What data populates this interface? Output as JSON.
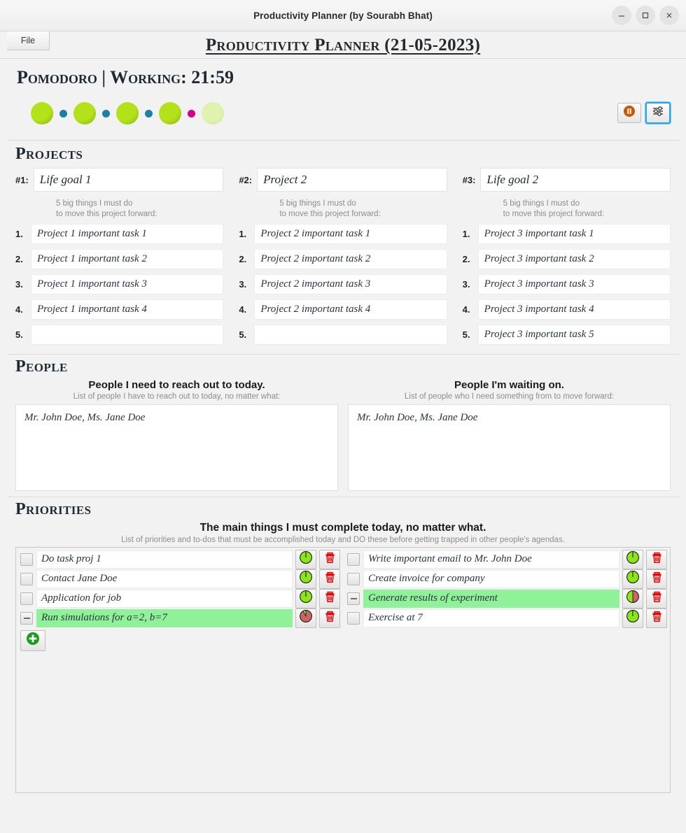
{
  "window": {
    "title": "Productivity Planner (by Sourabh Bhat)",
    "controls": {
      "minimize": "minimize-icon",
      "maximize": "maximize-icon",
      "close": "close-icon"
    }
  },
  "menubar": {
    "file_label": "File"
  },
  "app_title": "Productivity Planner (21-05-2023)",
  "pomodoro": {
    "heading": "Pomodoro | Working: 21:59",
    "markers": [
      {
        "kind": "big",
        "color": "#b3e11a",
        "state": "done"
      },
      {
        "kind": "small",
        "color": "#1781a8",
        "state": "break"
      },
      {
        "kind": "big",
        "color": "#b3e11a",
        "state": "done"
      },
      {
        "kind": "small",
        "color": "#1781a8",
        "state": "break"
      },
      {
        "kind": "big",
        "color": "#b3e11a",
        "state": "done"
      },
      {
        "kind": "small",
        "color": "#1781a8",
        "state": "break"
      },
      {
        "kind": "big",
        "color": "#b3e11a",
        "state": "done"
      },
      {
        "kind": "small",
        "color": "#d4008c",
        "state": "current"
      },
      {
        "kind": "big",
        "color": "#dff2b0",
        "state": "pending"
      }
    ],
    "pause_button": "pause-icon",
    "settings_button": "sliders-icon"
  },
  "projects": {
    "section_title": "Projects",
    "hint": "5 big things I must do\nto move this project forward:",
    "columns": [
      {
        "number": "#1:",
        "name": "Life goal 1",
        "tasks": [
          {
            "n": "1.",
            "text": "Project 1 important task 1"
          },
          {
            "n": "2.",
            "text": "Project 1 important task 2"
          },
          {
            "n": "3.",
            "text": "Project 1 important task 3"
          },
          {
            "n": "4.",
            "text": "Project 1 important task 4"
          },
          {
            "n": "5.",
            "text": ""
          }
        ]
      },
      {
        "number": "#2:",
        "name": "Project 2",
        "tasks": [
          {
            "n": "1.",
            "text": "Project 2 important task 1"
          },
          {
            "n": "2.",
            "text": "Project 2 important task 2"
          },
          {
            "n": "3.",
            "text": "Project 2 important task 3"
          },
          {
            "n": "4.",
            "text": "Project 2 important task 4"
          },
          {
            "n": "5.",
            "text": ""
          }
        ]
      },
      {
        "number": "#3:",
        "name": "Life goal 2",
        "tasks": [
          {
            "n": "1.",
            "text": "Project 3 important task 1"
          },
          {
            "n": "2.",
            "text": "Project 3 important task 2"
          },
          {
            "n": "3.",
            "text": "Project 3 important task 3"
          },
          {
            "n": "4.",
            "text": "Project 3 important task 4"
          },
          {
            "n": "5.",
            "text": "Project 3 important task 5"
          }
        ]
      }
    ]
  },
  "people": {
    "section_title": "People",
    "columns": [
      {
        "heading": "People I need to reach out to today.",
        "subheading": "List of people I have to reach out to today, no matter what:",
        "value": "Mr. John Doe,  Ms. Jane Doe"
      },
      {
        "heading": "People I'm waiting on.",
        "subheading": "List of people who I need something from to move forward:",
        "value": "Mr. John Doe,  Ms. Jane Doe"
      }
    ]
  },
  "priorities": {
    "section_title": "Priorities",
    "heading": "The main things I must complete today, no matter what.",
    "subheading": "List of priorities and to-dos that must be accomplished today and DO these before getting trapped in other people's agendas.",
    "add_button": "add-icon",
    "left_items": [
      {
        "text": "Do task proj 1",
        "checkbox": "empty",
        "active": false,
        "timer": "full-green",
        "delete": "trash-icon"
      },
      {
        "text": "Contact Jane Doe",
        "checkbox": "empty",
        "active": false,
        "timer": "full-green",
        "delete": "trash-icon"
      },
      {
        "text": "Application for job",
        "checkbox": "empty",
        "active": false,
        "timer": "full-green",
        "delete": "trash-icon"
      },
      {
        "text": "Run simulations for a=2, b=7",
        "checkbox": "indeterminate",
        "active": true,
        "timer": "mostly-red",
        "delete": "trash-icon"
      }
    ],
    "right_items": [
      {
        "text": "Write important email to Mr. John Doe",
        "checkbox": "empty",
        "active": false,
        "timer": "full-green",
        "delete": "trash-icon"
      },
      {
        "text": "Create invoice for company",
        "checkbox": "empty",
        "active": false,
        "timer": "full-green",
        "delete": "trash-icon"
      },
      {
        "text": "Generate results of experiment",
        "checkbox": "indeterminate",
        "active": true,
        "timer": "half-red",
        "delete": "trash-icon"
      },
      {
        "text": "Exercise at 7",
        "checkbox": "empty",
        "active": false,
        "timer": "full-green",
        "delete": "trash-icon"
      }
    ]
  },
  "colors": {
    "accent_green": "#b3e11a",
    "active_row": "#8ff299",
    "break_blue": "#1781a8",
    "current_pink": "#d4008c",
    "delete_red": "#f00000",
    "pause_orange": "#cc5500",
    "focus_blue": "#2aa3e8"
  }
}
